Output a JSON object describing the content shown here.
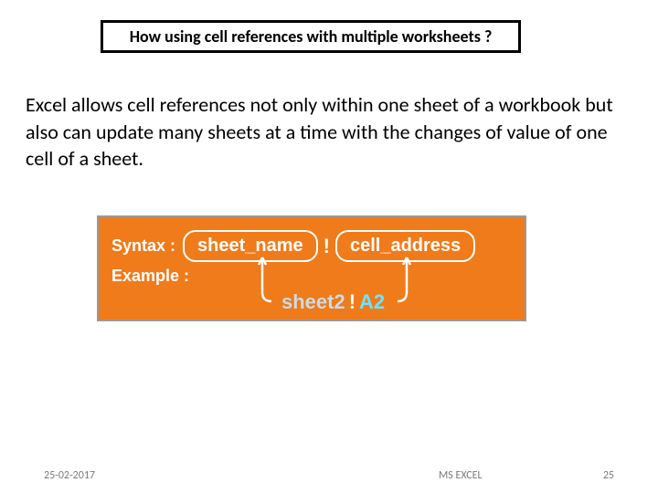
{
  "title": "How using cell references with multiple worksheets ?",
  "body": "Excel allows cell references not only within one sheet of a workbook but also can update many sheets at a time with the changes of value of one cell of a sheet.",
  "diagram": {
    "syntax_label": "Syntax :",
    "sheet_name_token": "sheet_name",
    "separator_top": "!",
    "cell_address_token": "cell_address",
    "example_label": "Example :",
    "example_sheet": "sheet2",
    "example_sep": "!",
    "example_cell": "A2"
  },
  "footer": {
    "date": "25-02-2017",
    "center": "MS EXCEL",
    "page": "25"
  }
}
